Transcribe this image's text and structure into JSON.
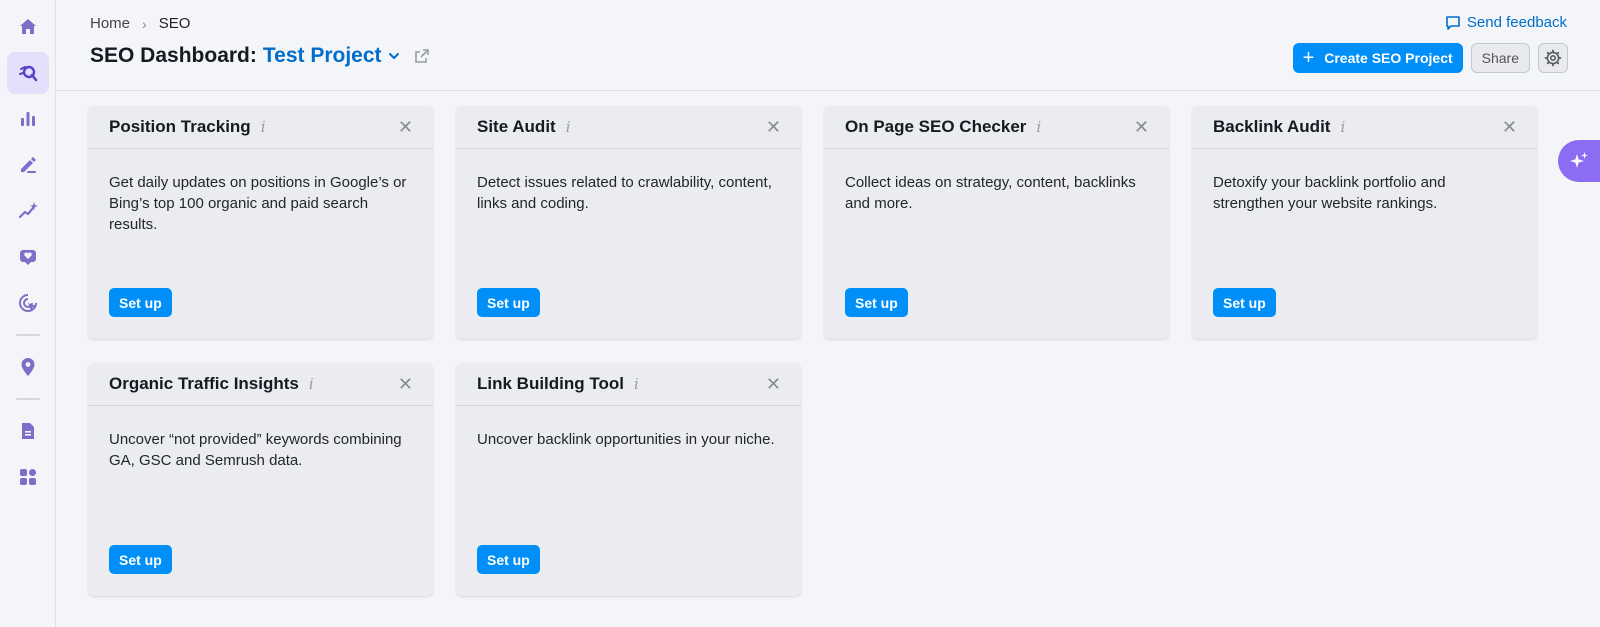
{
  "sidebar": {
    "items": [
      {
        "icon": "home-icon",
        "active": false
      },
      {
        "icon": "seo-icon",
        "active": true
      },
      {
        "icon": "bar-chart-icon",
        "active": false
      },
      {
        "icon": "content-pen-icon",
        "active": false
      },
      {
        "icon": "sparkle-trend-icon",
        "active": false
      },
      {
        "icon": "heart-chat-icon",
        "active": false
      },
      {
        "icon": "cursor-target-icon",
        "active": false
      },
      {
        "icon": "location-pin-icon",
        "active": false
      },
      {
        "icon": "report-document-icon",
        "active": false
      },
      {
        "icon": "apps-grid-icon",
        "active": false
      }
    ]
  },
  "breadcrumb": {
    "home": "Home",
    "current": "SEO"
  },
  "header": {
    "title": "SEO Dashboard:",
    "project": "Test Project",
    "feedback": "Send feedback",
    "create_button": "Create SEO Project",
    "share_button": "Share"
  },
  "cards": [
    {
      "title": "Position Tracking",
      "description": "Get daily updates on positions in Google’s or Bing’s top 100 organic and paid search results.",
      "button": "Set up"
    },
    {
      "title": "Site Audit",
      "description": "Detect issues related to crawlability, content, links and coding.",
      "button": "Set up"
    },
    {
      "title": "On Page SEO Checker",
      "description": "Collect ideas on strategy, content, backlinks and more.",
      "button": "Set up"
    },
    {
      "title": "Backlink Audit",
      "description": "Detoxify your backlink portfolio and strengthen your website rankings.",
      "button": "Set up"
    },
    {
      "title": "Organic Traffic Insights",
      "description": "Uncover “not provided” keywords combining GA, GSC and Semrush data.",
      "button": "Set up"
    },
    {
      "title": "Link Building Tool",
      "description": "Uncover backlink opportunities in your niche.",
      "button": "Set up"
    }
  ],
  "colors": {
    "accent": "#008ff8",
    "link": "#006dca",
    "sidebar_icon": "#7f6ec7",
    "ai": "#8b6cf2"
  }
}
